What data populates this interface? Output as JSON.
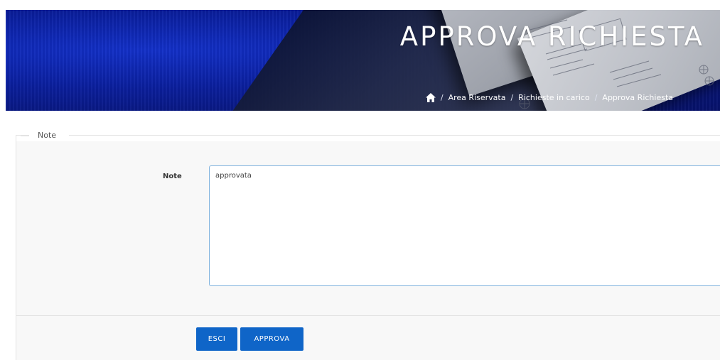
{
  "header": {
    "title": "APPROVA RICHIESTA",
    "breadcrumb": {
      "home_icon": "home-icon",
      "separator": "/",
      "items": [
        "Area Riservata",
        "Richieste in carico",
        "Approva Richiesta"
      ]
    }
  },
  "form": {
    "legend": "Note",
    "note_label": "Note",
    "note_value": "approvata"
  },
  "actions": {
    "exit_label": "ESCI",
    "approve_label": "APPROVA"
  },
  "colors": {
    "banner": "#0a1e9c",
    "button": "#0f65c8",
    "input_border": "#7fb2de"
  }
}
